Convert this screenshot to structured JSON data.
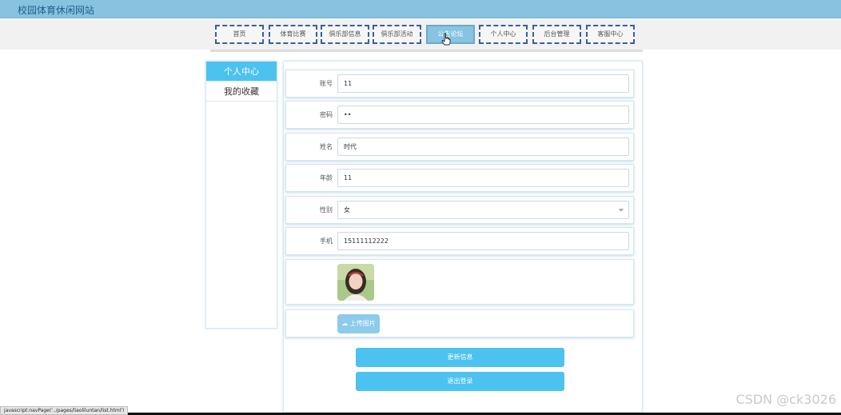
{
  "header": {
    "site_title": "校园体育休闲网站"
  },
  "nav": {
    "items": [
      {
        "label": "首页"
      },
      {
        "label": "体育比赛"
      },
      {
        "label": "俱乐部信息"
      },
      {
        "label": "俱乐部活动"
      },
      {
        "label": "公告论坛"
      },
      {
        "label": "个人中心"
      },
      {
        "label": "后台管理"
      },
      {
        "label": "客服中心"
      }
    ],
    "active_index": 4
  },
  "sidebar": {
    "items": [
      {
        "label": "个人中心"
      },
      {
        "label": "我的收藏"
      }
    ]
  },
  "form": {
    "account": {
      "label": "账号",
      "value": "11"
    },
    "password": {
      "label": "密码",
      "value": "••"
    },
    "name": {
      "label": "姓名",
      "value": "时代"
    },
    "age": {
      "label": "年龄",
      "value": "11"
    },
    "gender": {
      "label": "性别",
      "value": "女"
    },
    "phone": {
      "label": "手机",
      "value": "15111112222"
    },
    "upload_label": "上传图片",
    "update_label": "更新信息",
    "logout_label": "退出登录"
  },
  "status_bar": {
    "text": "javascript:navPage('../pages/liaoliluntan/list.html')"
  },
  "watermark": "CSDN @ck3026",
  "colors": {
    "accent": "#4cc2f0",
    "header": "#87c3e1",
    "nav_border": "#3a5f9a"
  }
}
